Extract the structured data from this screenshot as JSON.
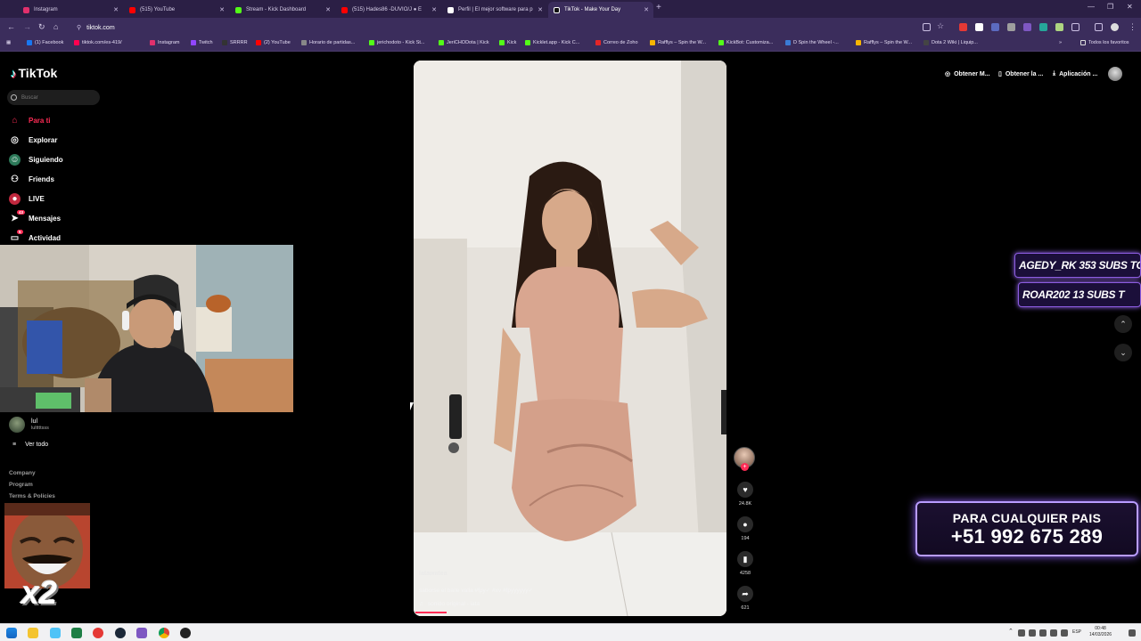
{
  "browser": {
    "tabs": [
      {
        "title": "Instagram",
        "color": "#e1306c"
      },
      {
        "title": "(515) YouTube",
        "color": "#ff0000"
      },
      {
        "title": "Stream - Kick Dashboard",
        "color": "#53fc18"
      },
      {
        "title": "(515) Hades86 -DUVIO/J ● E",
        "color": "#ff0000"
      },
      {
        "title": "Perfil | El mejor software para p",
        "color": "#ffffff"
      },
      {
        "title": "TikTok - Make Your Day",
        "color": "#111111"
      }
    ],
    "url": "tiktok.com",
    "bookmarks": [
      {
        "label": "(1) Facebook",
        "color": "#1877f2"
      },
      {
        "label": "tiktok.com/es-419/",
        "color": "#ff0050"
      },
      {
        "label": "Instagram",
        "color": "#e1306c"
      },
      {
        "label": "Twitch",
        "color": "#9146ff"
      },
      {
        "label": "SRRRR",
        "color": "#333333"
      },
      {
        "label": "(2) YouTube",
        "color": "#ff0000"
      },
      {
        "label": "Horario de partidas...",
        "color": "#888888"
      },
      {
        "label": "jerichodoto - Kick St...",
        "color": "#53fc18"
      },
      {
        "label": "JeriCHODota | Kick",
        "color": "#53fc18"
      },
      {
        "label": "Kick",
        "color": "#53fc18"
      },
      {
        "label": "Kicklet.app - Kick C...",
        "color": "#53fc18"
      },
      {
        "label": "Correo de Zoho",
        "color": "#e42527"
      },
      {
        "label": "Rafflys – Spin the W...",
        "color": "#f7b500"
      },
      {
        "label": "KickBot: Customiza...",
        "color": "#53fc18"
      },
      {
        "label": "D Spin the Wheel -...",
        "color": "#3a7bd5"
      },
      {
        "label": "Rafflys – Spin the W...",
        "color": "#f7b500"
      },
      {
        "label": "Dota 2 Wiki | Liquip...",
        "color": "#444444"
      }
    ],
    "all_favorites": "Todos los favoritos"
  },
  "tiktok": {
    "logo": "TikTok",
    "search_placeholder": "Buscar",
    "nav": [
      {
        "label": "Para ti",
        "icon": "home-icon"
      },
      {
        "label": "Explorar",
        "icon": "compass-icon"
      },
      {
        "label": "Siguiendo",
        "icon": "following-icon"
      },
      {
        "label": "Friends",
        "icon": "friends-icon"
      },
      {
        "label": "LIVE",
        "icon": "live-icon"
      },
      {
        "label": "Mensajes",
        "icon": "messages-icon",
        "badge": "43"
      },
      {
        "label": "Actividad",
        "icon": "activity-icon",
        "badge": "5"
      }
    ],
    "following_user": {
      "name": "lul",
      "handle": "lulttttsss"
    },
    "ver_todo": "Ver todo",
    "footer": [
      "Company",
      "Program",
      "Terms & Policies"
    ],
    "top_actions": [
      "Obtener M...",
      "Obtener la ...",
      "Aplicación ..."
    ],
    "video": {
      "username": "latawatea",
      "caption": "saborse el baile valla #fpy✓ #xv #fpyyyyyy✓",
      "sound": "sonido original - iata",
      "likes": "24.8K",
      "comments": "194",
      "saves": "4258",
      "shares": "621",
      "progress_fraction": 0.1
    }
  },
  "overlay": {
    "subs_1": "AGEDY_RK 353 SUBS  TOP",
    "subs_2": "ROAR202 13 SUBS    T",
    "promo_line1": "PARA CUALQUIER PAIS",
    "promo_line2": "+51 992 675 289",
    "meme_text": "x2"
  },
  "taskbar": {
    "lang": "ESP",
    "time": "00:48",
    "date": "14/03/2026"
  }
}
